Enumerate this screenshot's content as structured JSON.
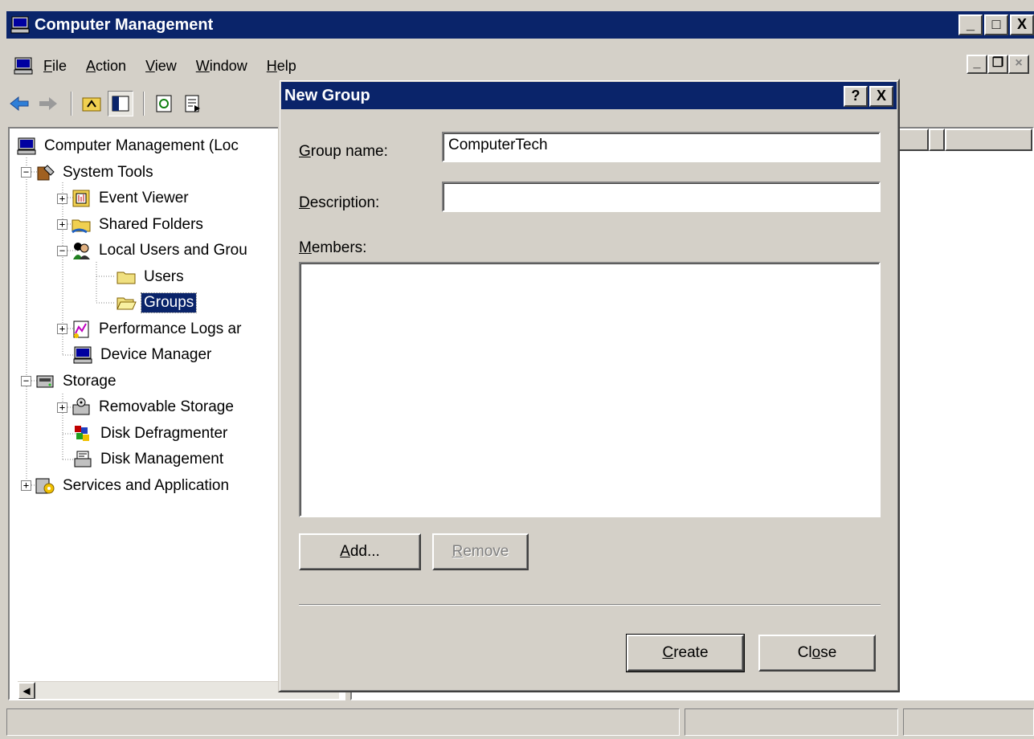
{
  "window": {
    "title": "Computer Management",
    "caption_buttons": [
      "_",
      "□",
      "X"
    ]
  },
  "menubar": {
    "items": [
      {
        "label": "File",
        "accel": "F",
        "rest": "ile"
      },
      {
        "label": "Action",
        "accel": "A",
        "rest": "ction"
      },
      {
        "label": "View",
        "accel": "V",
        "rest": "iew"
      },
      {
        "label": "Window",
        "accel": "W",
        "rest": "indow"
      },
      {
        "label": "Help",
        "accel": "H",
        "rest": "elp"
      }
    ]
  },
  "tree": {
    "root": "Computer Management (Loc",
    "system_tools": "System Tools",
    "event_viewer": "Event Viewer",
    "shared_folders": "Shared Folders",
    "local_users": "Local Users and Grou",
    "users": "Users",
    "groups": "Groups",
    "perf_logs": "Performance Logs ar",
    "device_manager": "Device Manager",
    "storage": "Storage",
    "removable_storage": "Removable Storage",
    "disk_defrag": "Disk Defragmenter",
    "disk_management": "Disk Management",
    "services": "Services and Application"
  },
  "dialog": {
    "title": "New Group",
    "help_btn": "?",
    "close_btn": "X",
    "group_name_label": {
      "accel": "G",
      "rest": "roup name:"
    },
    "group_name_value": "ComputerTech",
    "description_label": {
      "accel": "D",
      "rest": "escription:"
    },
    "description_value": "",
    "members_label": {
      "accel": "M",
      "rest": "embers:"
    },
    "add_btn": {
      "accel": "A",
      "rest": "dd..."
    },
    "remove_btn": {
      "accel": "R",
      "rest": "emove"
    },
    "create_btn": {
      "accel": "C",
      "rest": "reate"
    },
    "close_button": {
      "pre": "Cl",
      "accel": "o",
      "rest": "se"
    }
  }
}
